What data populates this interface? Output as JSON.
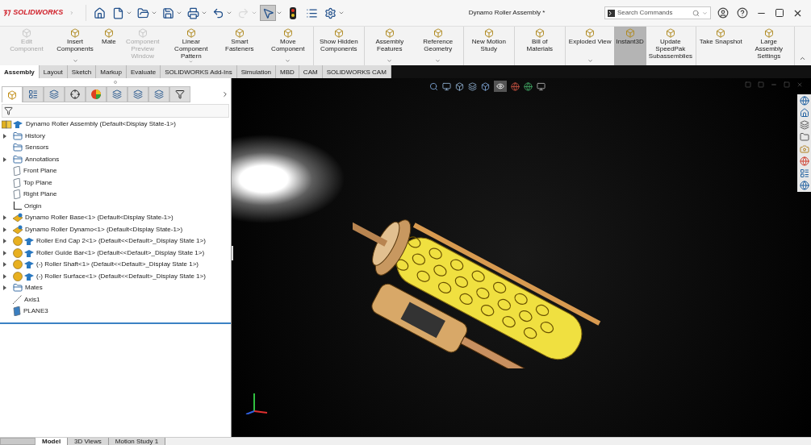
{
  "app_name": "SOLIDWORKS",
  "quick_toolbar": [
    {
      "kind": "home",
      "disabled": false,
      "selected": false,
      "dropdown": false
    },
    {
      "kind": "new",
      "disabled": false,
      "selected": false,
      "dropdown": true
    },
    {
      "kind": "open",
      "disabled": false,
      "selected": false,
      "dropdown": true
    },
    {
      "kind": "save",
      "disabled": false,
      "selected": false,
      "dropdown": true
    },
    {
      "kind": "print",
      "disabled": false,
      "selected": false,
      "dropdown": true
    },
    {
      "kind": "undo",
      "disabled": false,
      "selected": false,
      "dropdown": true
    },
    {
      "kind": "redo",
      "disabled": true,
      "selected": false,
      "dropdown": true
    },
    {
      "kind": "select",
      "disabled": false,
      "selected": true,
      "dropdown": true
    },
    {
      "kind": "rebuild",
      "disabled": false,
      "selected": false,
      "dropdown": false
    },
    {
      "kind": "properties",
      "disabled": false,
      "selected": false,
      "dropdown": false
    },
    {
      "kind": "options",
      "disabled": false,
      "selected": false,
      "dropdown": true
    }
  ],
  "window": {
    "title": "Dynamo Roller Assembly *"
  },
  "search": {
    "placeholder": "Search Commands"
  },
  "ribbon_groups": [
    {
      "items": [
        {
          "label": "Edit Component",
          "disabled": true,
          "selected": false,
          "dropdown": false
        },
        {
          "label": "Insert Components",
          "disabled": false,
          "selected": false,
          "dropdown": true
        },
        {
          "label": "Mate",
          "disabled": false,
          "selected": false,
          "dropdown": false
        },
        {
          "label": "Component Preview Window",
          "disabled": true,
          "selected": false,
          "dropdown": false
        },
        {
          "label": "Linear Component Pattern",
          "disabled": false,
          "selected": false,
          "dropdown": true
        },
        {
          "label": "Smart Fasteners",
          "disabled": false,
          "selected": false,
          "dropdown": false
        },
        {
          "label": "Move Component",
          "disabled": false,
          "selected": false,
          "dropdown": true
        }
      ]
    },
    {
      "items": [
        {
          "label": "Show Hidden Components",
          "disabled": false,
          "selected": false,
          "dropdown": false
        }
      ]
    },
    {
      "items": [
        {
          "label": "Assembly Features",
          "disabled": false,
          "selected": false,
          "dropdown": true
        },
        {
          "label": "Reference Geometry",
          "disabled": false,
          "selected": false,
          "dropdown": true
        }
      ]
    },
    {
      "items": [
        {
          "label": "New Motion Study",
          "disabled": false,
          "selected": false,
          "dropdown": false
        }
      ]
    },
    {
      "items": [
        {
          "label": "Bill of Materials",
          "disabled": false,
          "selected": false,
          "dropdown": false
        }
      ]
    },
    {
      "items": [
        {
          "label": "Exploded View",
          "disabled": false,
          "selected": false,
          "dropdown": true
        },
        {
          "label": "Instant3D",
          "disabled": false,
          "selected": true,
          "dropdown": false
        },
        {
          "label": "Update SpeedPak Subassemblies",
          "disabled": false,
          "selected": false,
          "dropdown": false
        }
      ]
    },
    {
      "items": [
        {
          "label": "Take Snapshot",
          "disabled": false,
          "selected": false,
          "dropdown": false
        },
        {
          "label": "Large Assembly Settings",
          "disabled": false,
          "selected": false,
          "dropdown": false
        }
      ]
    }
  ],
  "command_tabs": [
    {
      "label": "Assembly",
      "selected": true
    },
    {
      "label": "Layout",
      "selected": false
    },
    {
      "label": "Sketch",
      "selected": false
    },
    {
      "label": "Markup",
      "selected": false
    },
    {
      "label": "Evaluate",
      "selected": false
    },
    {
      "label": "SOLIDWORKS Add-Ins",
      "selected": false
    },
    {
      "label": "Simulation",
      "selected": false
    },
    {
      "label": "MBD",
      "selected": false
    },
    {
      "label": "CAM",
      "selected": false
    },
    {
      "label": "SOLIDWORKS CAM",
      "selected": false
    }
  ],
  "manager_tabs": [
    {
      "kind": "feature",
      "selected": true
    },
    {
      "kind": "property",
      "selected": false
    },
    {
      "kind": "config",
      "selected": false
    },
    {
      "kind": "dimxpert",
      "selected": false
    },
    {
      "kind": "display",
      "selected": false
    },
    {
      "kind": "cam",
      "selected": false
    },
    {
      "kind": "camtree",
      "selected": false
    },
    {
      "kind": "tool",
      "selected": false
    },
    {
      "kind": "filter",
      "selected": false
    }
  ],
  "feature_tree": {
    "label": "Dynamo Roller Assembly  (Default<Display State-1>)",
    "kind": "assembly",
    "children": [
      {
        "label": "History",
        "kind": "history",
        "expandable": true
      },
      {
        "label": "Sensors",
        "kind": "sensors",
        "expandable": false
      },
      {
        "label": "Annotations",
        "kind": "annotations",
        "expandable": true
      },
      {
        "label": "Front Plane",
        "kind": "plane",
        "expandable": false
      },
      {
        "label": "Top Plane",
        "kind": "plane",
        "expandable": false
      },
      {
        "label": "Right Plane",
        "kind": "plane",
        "expandable": false
      },
      {
        "label": "Origin",
        "kind": "origin",
        "expandable": false
      },
      {
        "label": "Dynamo Roller Base<1> (Default<Display State-1>)",
        "kind": "part",
        "expandable": true
      },
      {
        "label": "Dynamo Roller Dynamo<1> (Default<Display State-1>)",
        "kind": "subassembly",
        "expandable": true
      },
      {
        "label": "Roller End Cap 2<1> (Default<<Default>_Display State 1>)",
        "kind": "component",
        "expandable": true
      },
      {
        "label": "Roller Guide Bar<1> (Default<<Default>_Display State 1>)",
        "kind": "component",
        "expandable": true
      },
      {
        "label": "(-) Roller Shaft<1> (Default<<Default>_Display State 1>)",
        "kind": "component",
        "expandable": true
      },
      {
        "label": "(-) Roller Surface<1> (Default<<Default>_Display State 1>)",
        "kind": "component",
        "expandable": true
      },
      {
        "label": "Mates",
        "kind": "mates",
        "expandable": true
      },
      {
        "label": "Axis1",
        "kind": "axis",
        "expandable": false
      },
      {
        "label": "PLANE3",
        "kind": "refplane",
        "expandable": false
      }
    ]
  },
  "bottom_tabs": [
    {
      "label": "Model",
      "selected": true
    },
    {
      "label": "3D Views",
      "selected": false
    },
    {
      "label": "Motion Study 1",
      "selected": false
    }
  ]
}
